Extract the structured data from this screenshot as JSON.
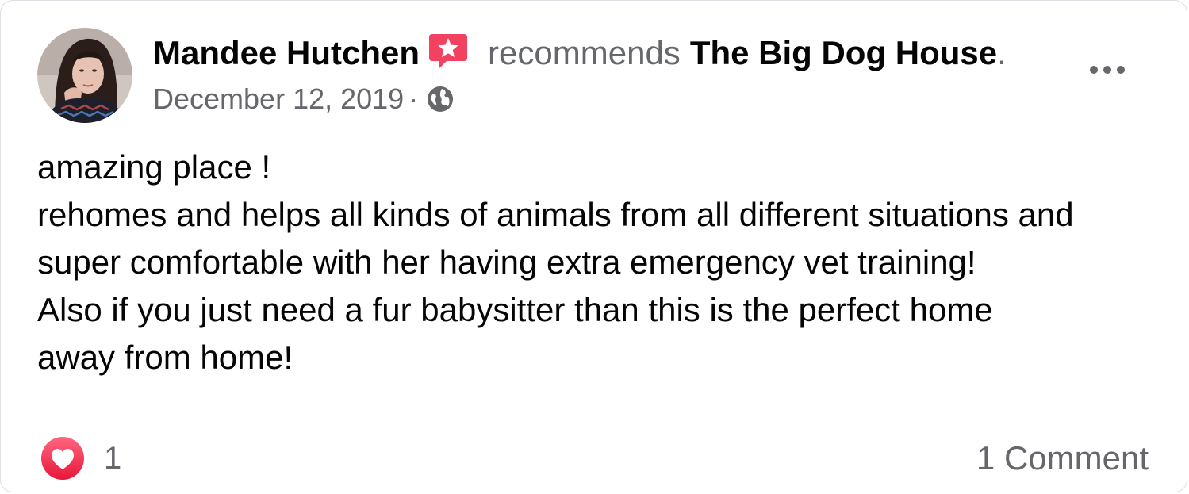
{
  "post": {
    "author": "Mandee Hutchen",
    "action": "recommends",
    "page_name": "The Big Dog House",
    "period": ".",
    "date": "December 12, 2019",
    "separator": "·",
    "audience_icon": "globe-icon",
    "badge_icon": "recommendation-star-icon",
    "body_lines": [
      "amazing place !",
      "rehomes and helps all kinds of animals from all different situations and",
      "super comfortable with her having extra emergency vet training!",
      "Also if you just need a fur babysitter than this is the perfect home",
      "away from home!"
    ]
  },
  "footer": {
    "reaction_icon": "love-reaction-icon",
    "reaction_count": "1",
    "comment_count": "1 Comment"
  },
  "colors": {
    "primary_text": "#050505",
    "secondary_text": "#65676b",
    "badge_red": "#f3425f",
    "love_red": "#f33e58"
  }
}
